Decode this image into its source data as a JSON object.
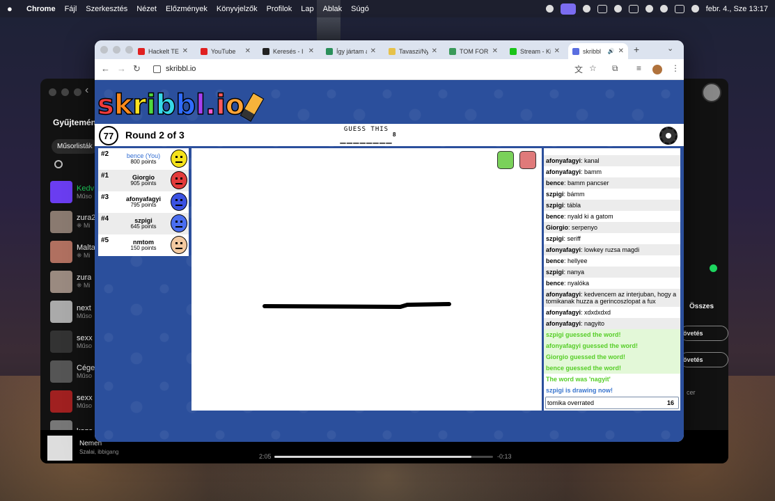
{
  "menubar": {
    "app": "Chrome",
    "items": [
      "Fájl",
      "Szerkesztés",
      "Nézet",
      "Előzmények",
      "Könyvjelzők",
      "Profilok",
      "Lap",
      "Ablak",
      "Súgó"
    ],
    "clock": "febr. 4., Sze  13:17"
  },
  "spotify": {
    "title": "Gyűjtemény",
    "chip": "Műsorlisták",
    "items": [
      {
        "title": "Kedv",
        "sub": "Műso"
      },
      {
        "title": "zura2",
        "sub": "⁜ Mi"
      },
      {
        "title": "Malta",
        "sub": "⁜ Mi"
      },
      {
        "title": "zura",
        "sub": "⁜ Mi"
      },
      {
        "title": "next",
        "sub": "Műso"
      },
      {
        "title": "sexx",
        "sub": "Műso"
      },
      {
        "title": "Cége",
        "sub": "Műso"
      },
      {
        "title": "sexx",
        "sub": "Műso"
      },
      {
        "title": "kozo",
        "sub": ""
      }
    ],
    "follow1": "övetés",
    "follow2": "övetés",
    "all": "Összes",
    "cer": "cer",
    "now_playing": {
      "song": "Nemen",
      "artist": "Szalai, ibbigang",
      "elapsed": "2:05",
      "remaining": "-0:13",
      "progress": 0.9
    }
  },
  "chrome": {
    "tabs": [
      {
        "title": "Hackelt TE",
        "fav": "#e02020"
      },
      {
        "title": "YouTube",
        "fav": "#e02020"
      },
      {
        "title": "Keresés - I",
        "fav": "#222222"
      },
      {
        "title": "Így jártam a",
        "fav": "#2a8f5a"
      },
      {
        "title": "Tavaszi/Nyá",
        "fav": "#e6c14a"
      },
      {
        "title": "TOM FORD",
        "fav": "#3a9a5a"
      },
      {
        "title": "Stream - Ki",
        "fav": "#19c419"
      },
      {
        "title": "skribbl",
        "fav": "#5a6ee0"
      }
    ],
    "url": "skribbl.io"
  },
  "game": {
    "logo_letters": [
      {
        "ch": "s",
        "color": "#ef3b3b"
      },
      {
        "ch": "k",
        "color": "#ff8a1c"
      },
      {
        "ch": "r",
        "color": "#ffe31f"
      },
      {
        "ch": "i",
        "color": "#4fd93f"
      },
      {
        "ch": "b",
        "color": "#36d9e9"
      },
      {
        "ch": "b",
        "color": "#2f6bff"
      },
      {
        "ch": "l",
        "color": "#a63ff0"
      },
      {
        "ch": ".",
        "color": "#ff5ad1"
      },
      {
        "ch": "i",
        "color": "#ff5a5a"
      },
      {
        "ch": "o",
        "color": "#ffa436"
      }
    ],
    "timer": "77",
    "round": "Round 2 of 3",
    "guess_label": "GUESS THIS",
    "word": "________",
    "word_length": "8",
    "players": [
      {
        "rank": "#2",
        "name": "bence (You)",
        "points": "800 points",
        "you": true,
        "color": "#f5e21a"
      },
      {
        "rank": "#1",
        "name": "Giorgio",
        "points": "905 points",
        "you": false,
        "color": "#e23b3b"
      },
      {
        "rank": "#3",
        "name": "afonyafagyi",
        "points": "795 points",
        "you": false,
        "color": "#3b52e2"
      },
      {
        "rank": "#4",
        "name": "szpigi",
        "points": "645 points",
        "you": false,
        "color": "#4a6ef0"
      },
      {
        "rank": "#5",
        "name": "nmtom",
        "points": "150 points",
        "you": false,
        "color": "#f2c9a0"
      }
    ],
    "chat": [
      {
        "user": "afonyafagyi",
        "text": "kanal",
        "type": "normal"
      },
      {
        "user": "afonyafagyi",
        "text": "bamm",
        "type": "normal"
      },
      {
        "user": "bence",
        "text": "bamm pancser",
        "type": "normal"
      },
      {
        "user": "szpigi",
        "text": "bámm",
        "type": "normal"
      },
      {
        "user": "szpigi",
        "text": "tábla",
        "type": "normal"
      },
      {
        "user": "bence",
        "text": "nyald ki a gatom",
        "type": "normal"
      },
      {
        "user": "Giorgio",
        "text": "serpenyo",
        "type": "normal"
      },
      {
        "user": "szpigi",
        "text": "seriff",
        "type": "normal"
      },
      {
        "user": "afonyafagyi",
        "text": "lowkey ruzsa magdi",
        "type": "normal"
      },
      {
        "user": "bence",
        "text": "hellyee",
        "type": "normal"
      },
      {
        "user": "szpigi",
        "text": "nanya",
        "type": "normal"
      },
      {
        "user": "bence",
        "text": "nyalóka",
        "type": "normal"
      },
      {
        "user": "afonyafagyi",
        "text": "kedvencem az interjuban, hogy a tomikanak huzza a gerincoszlopat a fux",
        "type": "normal"
      },
      {
        "user": "afonyafagyi",
        "text": "xdxdxdxd",
        "type": "normal"
      },
      {
        "user": "afonyafagyi",
        "text": "nagyito",
        "type": "normal"
      },
      {
        "user": "",
        "text": "szpigi guessed the word!",
        "type": "green"
      },
      {
        "user": "",
        "text": "afonyafagyi guessed the word!",
        "type": "green"
      },
      {
        "user": "",
        "text": "Giorgio guessed the word!",
        "type": "green"
      },
      {
        "user": "",
        "text": "bence guessed the word!",
        "type": "green"
      },
      {
        "user": "",
        "text": "The word was 'nagyit'",
        "type": "green-plain"
      },
      {
        "user": "",
        "text": "szpigi is drawing now!",
        "type": "blue"
      }
    ],
    "chat_input": {
      "value": "tomika overrated",
      "remaining": "16"
    }
  }
}
